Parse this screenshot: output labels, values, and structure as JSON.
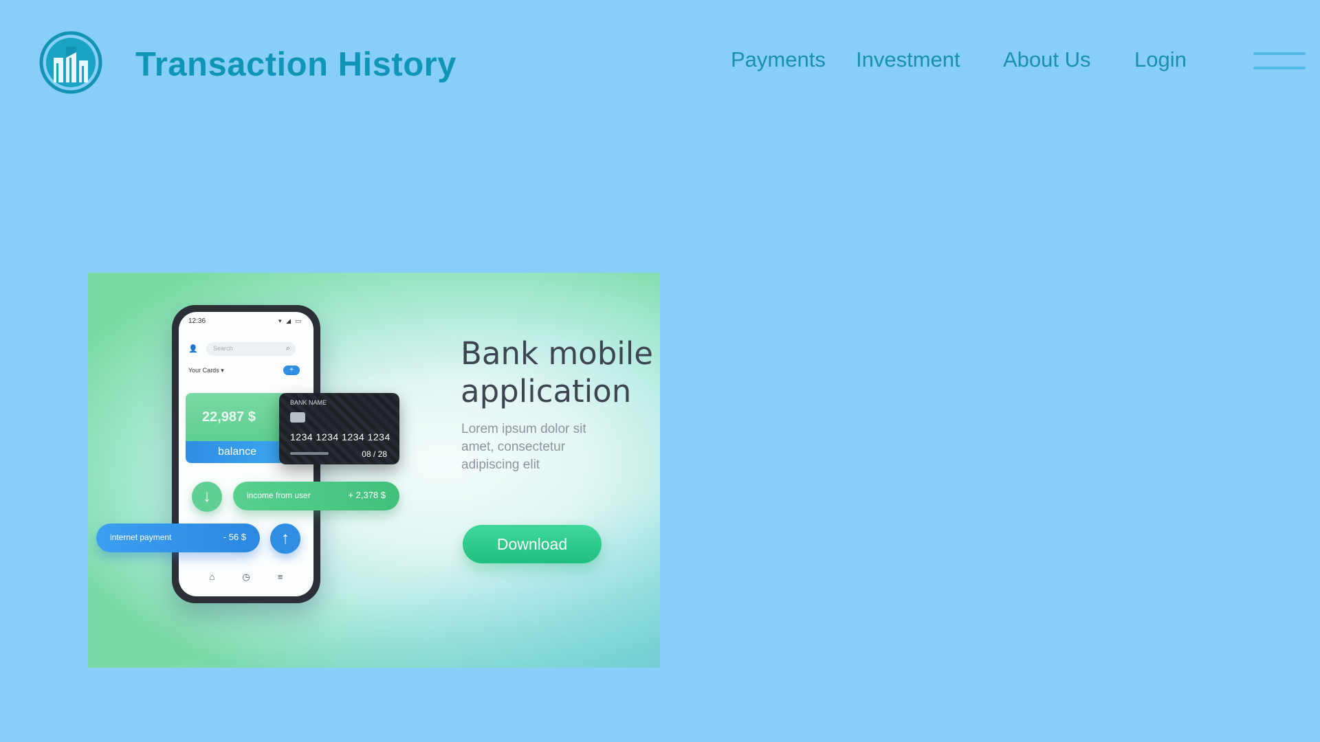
{
  "header": {
    "title": "Transaction History",
    "logo_icon": "bank-building-logo-icon",
    "nav": [
      {
        "label": "Payments"
      },
      {
        "label": "Investment"
      },
      {
        "label": "About Us"
      },
      {
        "label": "Login"
      }
    ],
    "menu_icon": "hamburger-menu-icon"
  },
  "banner": {
    "heading": "Bank mobile application",
    "body": "Lorem ipsum dolor sit amet, consectetur adipiscing elit",
    "download_label": "Download",
    "phone": {
      "time": "12:36",
      "search_placeholder": "Search",
      "cards_label": "Your Cards ▾",
      "balance_amount": "22,987 $",
      "balance_label": "balance",
      "income_label": "income from user",
      "income_value": "+ 2,378 $",
      "payment_label": "internet payment",
      "payment_value": "- 56 $"
    },
    "card": {
      "bank_name": "BANK NAME",
      "number": "1234 1234 1234 1234",
      "expiry": "08 / 28"
    }
  },
  "colors": {
    "background": "#87cff8",
    "accent": "#0f95b5",
    "download_green": "#1fbf80"
  }
}
